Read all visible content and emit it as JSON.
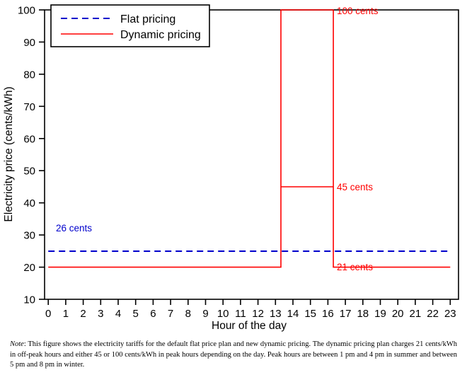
{
  "chart_data": {
    "type": "line",
    "title": "",
    "xlabel": "Hour of the day",
    "ylabel": "Electricity price (cents/kWh)",
    "xlim": [
      0,
      23
    ],
    "ylim": [
      10,
      100
    ],
    "xticks": [
      0,
      1,
      2,
      3,
      4,
      5,
      6,
      7,
      8,
      9,
      10,
      11,
      12,
      13,
      14,
      15,
      16,
      17,
      18,
      19,
      20,
      21,
      22,
      23
    ],
    "yticks": [
      10,
      20,
      30,
      40,
      50,
      60,
      70,
      80,
      90,
      100
    ],
    "grid": false,
    "legend_position": "top-left",
    "x": [
      0,
      1,
      2,
      3,
      4,
      5,
      6,
      7,
      8,
      9,
      10,
      11,
      12,
      13,
      14,
      15,
      16,
      17,
      18,
      19,
      20,
      21,
      22,
      23
    ],
    "series": [
      {
        "name": "Flat pricing",
        "color": "#0000cc",
        "style": "dashed",
        "values": [
          26,
          26,
          26,
          26,
          26,
          26,
          26,
          26,
          26,
          26,
          26,
          26,
          26,
          26,
          26,
          26,
          26,
          26,
          26,
          26,
          26,
          26,
          26,
          26
        ]
      },
      {
        "name": "Dynamic pricing",
        "color": "#ff0000",
        "style": "solid",
        "values": [
          21,
          21,
          21,
          21,
          21,
          21,
          21,
          21,
          21,
          21,
          21,
          21,
          21,
          100,
          100,
          100,
          21,
          21,
          21,
          21,
          21,
          21,
          21,
          21
        ],
        "peak_start_hour": 13,
        "peak_end_hour": 16,
        "off_peak_value": 21,
        "peak_values": [
          45,
          100
        ]
      }
    ],
    "annotations": [
      {
        "text": "100 cents",
        "color": "#ff0000",
        "value": 100,
        "hour": 16
      },
      {
        "text": "45 cents",
        "color": "#ff0000",
        "value": 45,
        "hour": 16
      },
      {
        "text": "21 cents",
        "color": "#ff0000",
        "value": 21,
        "hour": 16
      },
      {
        "text": "26 cents",
        "color": "#0000cc",
        "value": 26,
        "hour": 1
      }
    ]
  },
  "chart": {
    "ylabel": "Electricity price (cents/kWh)",
    "xlabel": "Hour of the day",
    "yticks": [
      "100",
      "90",
      "80",
      "70",
      "60",
      "50",
      "40",
      "30",
      "20",
      "10"
    ],
    "xticks": [
      "0",
      "1",
      "2",
      "3",
      "4",
      "5",
      "6",
      "7",
      "8",
      "9",
      "10",
      "11",
      "12",
      "13",
      "14",
      "15",
      "16",
      "17",
      "18",
      "19",
      "20",
      "21",
      "22",
      "23"
    ],
    "legend": {
      "items": [
        {
          "label": "Flat pricing",
          "color": "#0000cc",
          "style": "dashed"
        },
        {
          "label": "Dynamic pricing",
          "color": "#ff0000",
          "style": "solid"
        }
      ]
    },
    "annotations": {
      "peak_high": "100 cents",
      "peak_mid": "45 cents",
      "off_peak": "21 cents",
      "flat": "26 cents"
    }
  },
  "note": {
    "label": "Note",
    "separator": ": ",
    "text": "This figure shows the electricity tariffs for the default flat price plan and new dynamic pricing. The dynamic pricing plan charges 21 cents/kWh in off-peak hours and either 45 or 100 cents/kWh in peak hours depending on the day. Peak hours are between 1 pm and 4 pm in summer and between 5 pm and 8 pm in winter."
  }
}
